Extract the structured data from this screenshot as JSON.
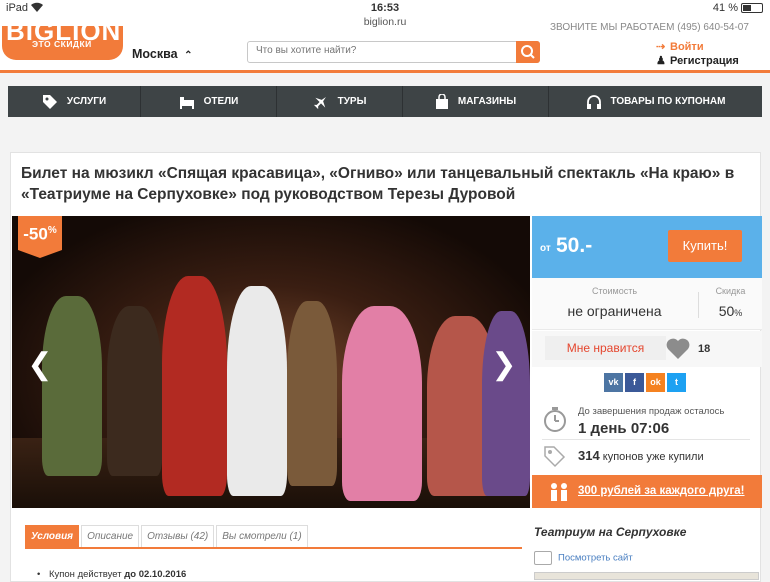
{
  "status_bar": {
    "device": "iPad",
    "time": "16:53",
    "url": "biglion.ru",
    "battery": "41 %"
  },
  "header": {
    "logo_text": "BIGLION",
    "logo_tagline": "ЭТО СКИДКИ",
    "city": "Москва",
    "search_placeholder": "Что вы хотите найти?",
    "login": "Войти",
    "register": "Регистрация",
    "cut_off_text": "ЗВОНИТЕ МЫ РАБОТАЕМ (495) 640-54-07"
  },
  "nav": [
    {
      "label": "УСЛУГИ",
      "icon": "tag-icon"
    },
    {
      "label": "ОТЕЛИ",
      "icon": "hotel-icon"
    },
    {
      "label": "ТУРЫ",
      "icon": "plane-icon"
    },
    {
      "label": "МАГАЗИНЫ",
      "icon": "shopping-bag-icon"
    },
    {
      "label": "ТОВАРЫ ПО КУПОНАМ",
      "icon": "headphones-icon"
    }
  ],
  "deal": {
    "title": "Билет на мюзикл «Спящая красавица», «Огниво» или танцевальный спектакль «На краю» в «Театриуме на Серпуховке» под руководством Терезы Дуровой",
    "discount_badge": "-50",
    "discount_badge_sup": "%",
    "price_prefix": "от",
    "price": "50.-",
    "buy_label": "Купить!",
    "cost_label": "Стоимость",
    "cost_value": "не ограничена",
    "discount_label": "Скидка",
    "discount_value": "50",
    "discount_unit": "%",
    "like_label": "Мне нравится",
    "like_count": "18",
    "social": [
      "vk",
      "facebook",
      "odnoklassniki",
      "twitter"
    ],
    "timer_label": "До завершения продаж осталось",
    "timer_value": "1 день 07:06",
    "coupons_count": "314",
    "coupons_label": "купонов уже купили",
    "invite_text": "300 рублей за каждого друга!"
  },
  "tabs": [
    {
      "label": "Условия",
      "active": true
    },
    {
      "label": "Описание",
      "active": false
    },
    {
      "label": "Отзывы (42)",
      "active": false
    },
    {
      "label": "Вы смотрели (1)",
      "active": false
    }
  ],
  "conditions": {
    "first_line_prefix": "Купон действует ",
    "first_line_date": "до 02.10.2016"
  },
  "venue": {
    "name": "Театриум на Серпуховке",
    "site_link": "Посмотреть сайт"
  },
  "colors": {
    "accent": "#f27b3a",
    "nav_bg": "#3e4446",
    "price_bg": "#5bb1ea",
    "like_text": "#e5462e"
  }
}
